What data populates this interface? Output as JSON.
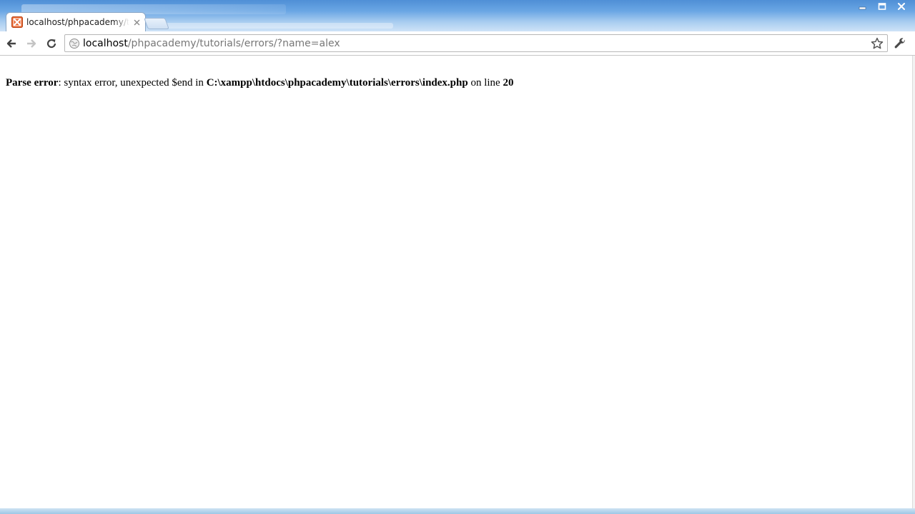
{
  "browser": {
    "tab": {
      "title": "localhost/phpacademy/tutorials/errors/?name=alex"
    },
    "address_bar": {
      "host": "localhost",
      "path": "/phpacademy/tutorials/errors/?name=alex"
    }
  },
  "page": {
    "error": {
      "type": "Parse error",
      "message": ": syntax error, unexpected $end in ",
      "file": "C:\\xampp\\htdocs\\phpacademy\\tutorials\\errors\\index.php",
      "on_line_text": " on line ",
      "line": "20"
    }
  },
  "colors": {
    "titlebar": "#6aa6e4",
    "favicon": "#e8652f",
    "url_path": "#777777"
  },
  "icons": [
    "back-arrow-icon",
    "forward-arrow-icon",
    "reload-icon",
    "globe-icon",
    "star-icon",
    "wrench-icon",
    "close-icon",
    "minimize-icon",
    "maximize-icon"
  ]
}
